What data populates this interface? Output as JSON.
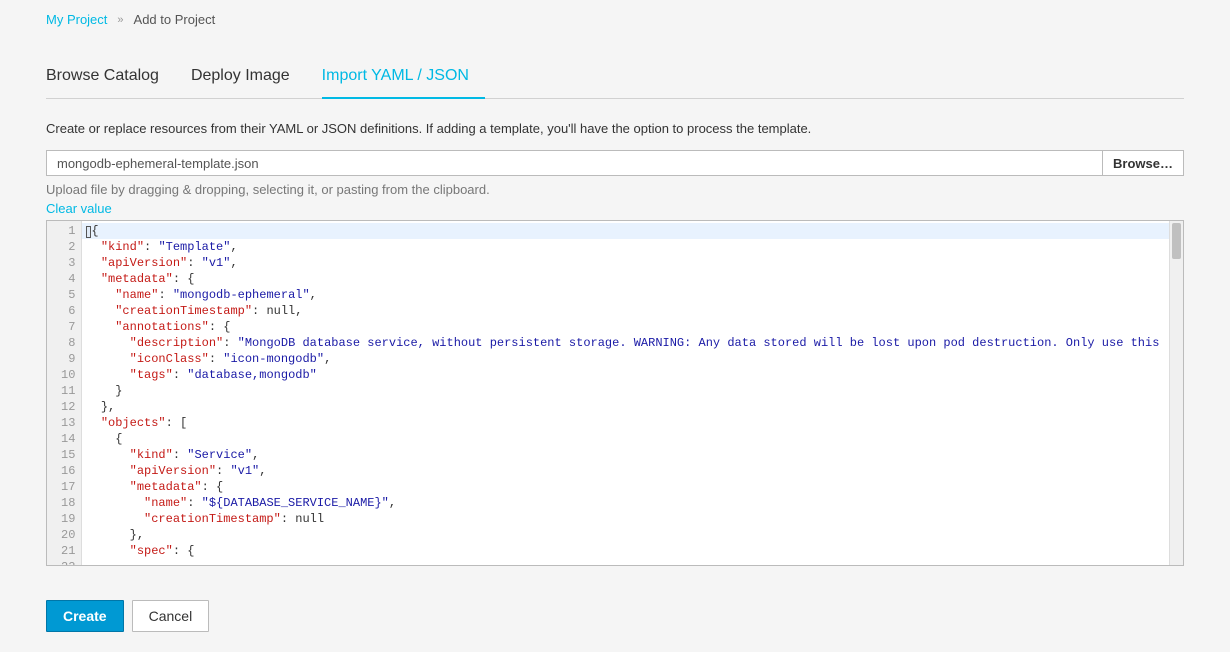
{
  "breadcrumb": {
    "project_link": "My Project",
    "current": "Add to Project"
  },
  "tabs": {
    "catalog": "Browse Catalog",
    "deploy": "Deploy Image",
    "import": "Import YAML / JSON"
  },
  "description": "Create or replace resources from their YAML or JSON definitions. If adding a template, you'll have the option to process the template.",
  "file_input_value": "mongodb-ephemeral-template.json",
  "browse_label": "Browse…",
  "upload_hint": "Upload file by dragging & dropping, selecting it, or pasting from the clipboard.",
  "clear_label": "Clear value",
  "buttons": {
    "create": "Create",
    "cancel": "Cancel"
  },
  "editor": {
    "line_count": 22,
    "lines": [
      [
        [
          "punc",
          "{"
        ]
      ],
      [
        [
          "indent",
          "  "
        ],
        [
          "key",
          "\"kind\""
        ],
        [
          "punc",
          ": "
        ],
        [
          "string",
          "\"Template\""
        ],
        [
          "punc",
          ","
        ]
      ],
      [
        [
          "indent",
          "  "
        ],
        [
          "key",
          "\"apiVersion\""
        ],
        [
          "punc",
          ": "
        ],
        [
          "string",
          "\"v1\""
        ],
        [
          "punc",
          ","
        ]
      ],
      [
        [
          "indent",
          "  "
        ],
        [
          "key",
          "\"metadata\""
        ],
        [
          "punc",
          ": {"
        ]
      ],
      [
        [
          "indent",
          "    "
        ],
        [
          "key",
          "\"name\""
        ],
        [
          "punc",
          ": "
        ],
        [
          "string",
          "\"mongodb-ephemeral\""
        ],
        [
          "punc",
          ","
        ]
      ],
      [
        [
          "indent",
          "    "
        ],
        [
          "key",
          "\"creationTimestamp\""
        ],
        [
          "punc",
          ": "
        ],
        [
          "null",
          "null"
        ],
        [
          "punc",
          ","
        ]
      ],
      [
        [
          "indent",
          "    "
        ],
        [
          "key",
          "\"annotations\""
        ],
        [
          "punc",
          ": {"
        ]
      ],
      [
        [
          "indent",
          "      "
        ],
        [
          "key",
          "\"description\""
        ],
        [
          "punc",
          ": "
        ],
        [
          "string",
          "\"MongoDB database service, without persistent storage. WARNING: Any data stored will be lost upon pod destruction. Only use this"
        ]
      ],
      [
        [
          "indent",
          "      "
        ],
        [
          "key",
          "\"iconClass\""
        ],
        [
          "punc",
          ": "
        ],
        [
          "string",
          "\"icon-mongodb\""
        ],
        [
          "punc",
          ","
        ]
      ],
      [
        [
          "indent",
          "      "
        ],
        [
          "key",
          "\"tags\""
        ],
        [
          "punc",
          ": "
        ],
        [
          "string",
          "\"database,mongodb\""
        ]
      ],
      [
        [
          "indent",
          "    "
        ],
        [
          "punc",
          "}"
        ]
      ],
      [
        [
          "indent",
          "  "
        ],
        [
          "punc",
          "},"
        ]
      ],
      [
        [
          "indent",
          "  "
        ],
        [
          "key",
          "\"objects\""
        ],
        [
          "punc",
          ": ["
        ]
      ],
      [
        [
          "indent",
          "    "
        ],
        [
          "punc",
          "{"
        ]
      ],
      [
        [
          "indent",
          "      "
        ],
        [
          "key",
          "\"kind\""
        ],
        [
          "punc",
          ": "
        ],
        [
          "string",
          "\"Service\""
        ],
        [
          "punc",
          ","
        ]
      ],
      [
        [
          "indent",
          "      "
        ],
        [
          "key",
          "\"apiVersion\""
        ],
        [
          "punc",
          ": "
        ],
        [
          "string",
          "\"v1\""
        ],
        [
          "punc",
          ","
        ]
      ],
      [
        [
          "indent",
          "      "
        ],
        [
          "key",
          "\"metadata\""
        ],
        [
          "punc",
          ": {"
        ]
      ],
      [
        [
          "indent",
          "        "
        ],
        [
          "key",
          "\"name\""
        ],
        [
          "punc",
          ": "
        ],
        [
          "string",
          "\"${DATABASE_SERVICE_NAME}\""
        ],
        [
          "punc",
          ","
        ]
      ],
      [
        [
          "indent",
          "        "
        ],
        [
          "key",
          "\"creationTimestamp\""
        ],
        [
          "punc",
          ": "
        ],
        [
          "null",
          "null"
        ]
      ],
      [
        [
          "indent",
          "      "
        ],
        [
          "punc",
          "},"
        ]
      ],
      [
        [
          "indent",
          "      "
        ],
        [
          "key",
          "\"spec\""
        ],
        [
          "punc",
          ": {"
        ]
      ],
      [
        [
          "indent",
          ""
        ]
      ]
    ]
  }
}
